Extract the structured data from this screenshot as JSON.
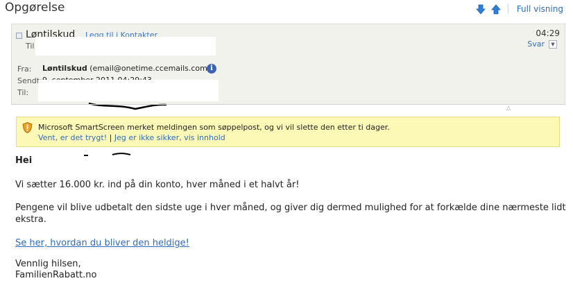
{
  "page": {
    "title": "Opgørelse"
  },
  "toolbar": {
    "full_view_label": "Full visning"
  },
  "message": {
    "sender_display": "Løntilskud",
    "add_contact_label": "Legg til i Kontakter",
    "time": "04:29",
    "reply_label": "Svar",
    "to_label_short": "Til",
    "from_label": "Fra:",
    "from_name": "Løntilskud",
    "from_email": "(email@onetime.ccemails.com)",
    "sent_label": "Sendt:",
    "sent_value": "9. september 2011 04:29:43",
    "to_label": "Til:"
  },
  "warning": {
    "text": "Microsoft SmartScreen merket meldingen som søppelpost, og vi vil slette den etter ti dager.",
    "link_safe": "Vent, er det trygt!",
    "separator": "|",
    "link_unsure": "Jeg er ikke sikker, vis innhold"
  },
  "body": {
    "greeting": "Hei",
    "line1": "Vi sætter 16.000 kr. ind på din konto, hver måned i et halvt år!",
    "line2a": "Pengene vil blive udbetalt den sidste uge i hver måned, og giver dig dermed mulighed for at forkælde dine nærmeste lidt",
    "line2b": "ekstra.",
    "link": "Se her, hvordan du bliver den heldige!",
    "signoff": "Vennlig hilsen,",
    "signature": "FamilienRabatt.no"
  },
  "colors": {
    "link": "#2e6bbd",
    "warning_bg": "#fcf8b6",
    "header_bg": "#f2f2ec",
    "arrow": "#2f7fd8"
  }
}
